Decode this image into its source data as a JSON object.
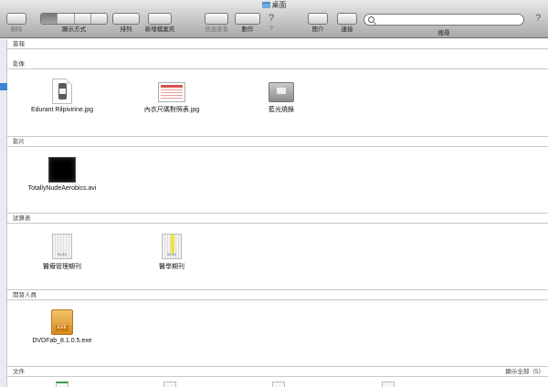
{
  "window": {
    "title": "桌面"
  },
  "toolbar": {
    "delete_label": "刪除",
    "view_label": "顯示方式",
    "arrange_label": "排列",
    "new_folder_label": "新增檔案夾",
    "quicklook_label": "快速查看",
    "action_label": "動作",
    "help_label": "?",
    "info_label": "簡介",
    "connect_label": "連接",
    "search_label": "搜尋",
    "search_placeholder": ""
  },
  "sections": {
    "favorites": {
      "title": "簽報"
    },
    "images": {
      "title": "影像",
      "items": [
        "Edurant Rilpivirine.jpg",
        "內衣尺碼對照表.jpg",
        "藍光燒錄"
      ]
    },
    "movies": {
      "title": "影片",
      "items": [
        "TotallyNudeAerobics.avi"
      ]
    },
    "spreadsheets": {
      "title": "試算表",
      "items": [
        "醫療管理期刊",
        "醫學期刊"
      ]
    },
    "developer": {
      "title": "開發人員",
      "items": [
        "DVDFab_8.1.0.5.exe"
      ]
    },
    "documents": {
      "title": "文件",
      "show_all": "顯示全部（5）"
    }
  },
  "icons": {
    "xlsx_tag": "XLSX",
    "exe_tag": "EXE"
  }
}
